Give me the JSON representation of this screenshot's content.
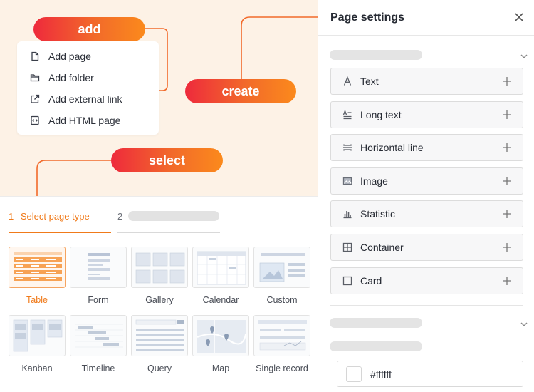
{
  "diagram": {
    "pills": {
      "add": "add",
      "create": "create",
      "select": "select"
    },
    "add_menu": [
      {
        "label": "Add page",
        "icon": "file-icon"
      },
      {
        "label": "Add folder",
        "icon": "folder-icon"
      },
      {
        "label": "Add external link",
        "icon": "external-link-icon"
      },
      {
        "label": "Add HTML page",
        "icon": "code-file-icon"
      }
    ],
    "accent_gradient": [
      "#ee2a3c",
      "#fb8a1c"
    ],
    "background": "#fdf2e6"
  },
  "wizard": {
    "steps": [
      {
        "number": "1",
        "label": "Select page type",
        "active": true
      },
      {
        "number": "2",
        "label": "",
        "active": false
      }
    ],
    "page_types": [
      {
        "label": "Table",
        "selected": true
      },
      {
        "label": "Form",
        "selected": false
      },
      {
        "label": "Gallery",
        "selected": false
      },
      {
        "label": "Calendar",
        "selected": false
      },
      {
        "label": "Custom",
        "selected": false
      },
      {
        "label": "Kanban",
        "selected": false
      },
      {
        "label": "Timeline",
        "selected": false
      },
      {
        "label": "Query",
        "selected": false
      },
      {
        "label": "Map",
        "selected": false
      },
      {
        "label": "Single record",
        "selected": false
      }
    ],
    "accent_color": "#f07a1a"
  },
  "panel": {
    "title": "Page settings",
    "elements": [
      {
        "label": "Text",
        "icon": "text-a-icon"
      },
      {
        "label": "Long text",
        "icon": "long-text-icon"
      },
      {
        "label": "Horizontal line",
        "icon": "horizontal-line-icon"
      },
      {
        "label": "Image",
        "icon": "image-icon"
      },
      {
        "label": "Statistic",
        "icon": "bar-chart-icon"
      },
      {
        "label": "Container",
        "icon": "grid-icon"
      },
      {
        "label": "Card",
        "icon": "square-icon"
      }
    ],
    "color_field": {
      "value": "#ffffff",
      "swatch": "#ffffff"
    }
  }
}
